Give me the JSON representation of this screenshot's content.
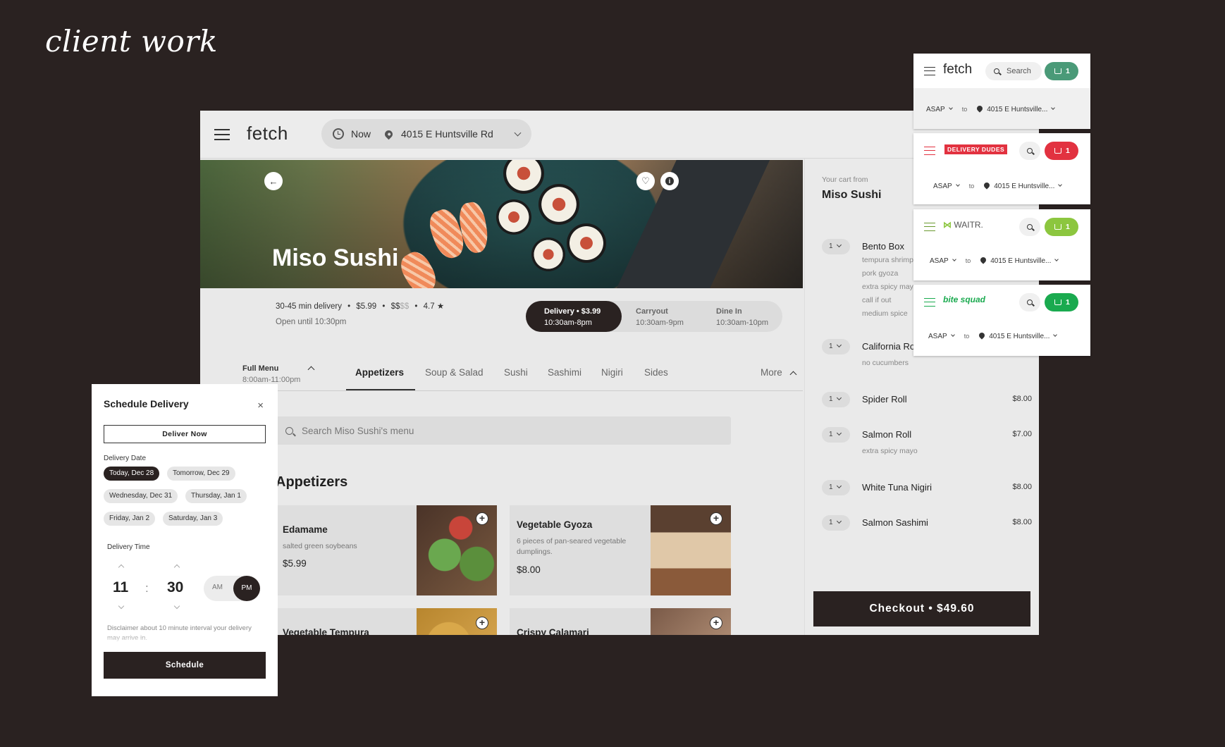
{
  "page_title": "client work",
  "app": {
    "logo": "fetch",
    "when": "Now",
    "address": "4015 E Huntsville Rd",
    "restaurant": "Miso Sushi",
    "meta_line_a": "30-45 min delivery",
    "meta_sep": "•",
    "delivery_fee": "$5.99",
    "price_dark": "$$",
    "price_dim": "$$",
    "rating": "4.7",
    "open_until": "Open until 10:30pm",
    "order_modes": [
      {
        "label": "Delivery • $3.99",
        "hours": "10:30am-8pm"
      },
      {
        "label": "Carryout",
        "hours": "10:30am-9pm"
      },
      {
        "label": "Dine In",
        "hours": "10:30am-10pm"
      }
    ],
    "full_menu": {
      "label": "Full Menu",
      "hours": "8:00am-11:00pm"
    },
    "tabs": [
      "Appetizers",
      "Soup & Salad",
      "Sushi",
      "Sashimi",
      "Nigiri",
      "Sides",
      "More"
    ],
    "search_placeholder": "Search Miso Sushi's menu",
    "section": "Appetizers",
    "items": [
      {
        "name": "Edamame",
        "desc": "salted green soybeans",
        "price": "$5.99"
      },
      {
        "name": "Vegetable Gyoza",
        "desc": "6 pieces of pan-seared vegetable dumplings.",
        "price": "$8.00"
      },
      {
        "name": "Vegetable Tempura",
        "desc": "",
        "price": ""
      },
      {
        "name": "Crispy Calamari",
        "desc": "",
        "price": ""
      }
    ]
  },
  "cart": {
    "from_label": "Your cart from",
    "restaurant": "Miso Sushi",
    "items": [
      {
        "qty": "1",
        "name": "Bento Box",
        "price": "",
        "notes": [
          "tempura shrimp",
          "pork gyoza",
          "extra spicy mayo",
          "call if out",
          "medium spice"
        ]
      },
      {
        "qty": "1",
        "name": "California Roll",
        "price": "",
        "notes": [
          "no cucumbers"
        ]
      },
      {
        "qty": "1",
        "name": "Spider Roll",
        "price": "$8.00",
        "notes": []
      },
      {
        "qty": "1",
        "name": "Salmon Roll",
        "price": "$7.00",
        "notes": [
          "extra spicy mayo"
        ]
      },
      {
        "qty": "1",
        "name": "White Tuna Nigiri",
        "price": "$8.00",
        "notes": []
      },
      {
        "qty": "1",
        "name": "Salmon Sashimi",
        "price": "$8.00",
        "notes": []
      }
    ],
    "checkout": "Checkout • $49.60"
  },
  "schedule": {
    "title": "Schedule Delivery",
    "close": "×",
    "deliver_now": "Deliver Now",
    "date_label": "Delivery Date",
    "dates": [
      "Today, Dec 28",
      "Tomorrow, Dec 29",
      "Wednesday, Dec 31",
      "Thursday, Jan 1",
      "Friday, Jan 2",
      "Saturday, Jan 3"
    ],
    "selected_date": "Today, Dec 28",
    "time_label": "Delivery Time",
    "hour": "11",
    "colon": ":",
    "minute": "30",
    "am": "AM",
    "pm": "PM",
    "selected_period": "PM",
    "disclaimer": "Disclaimer about 10 minute interval your delivery may arrive in.",
    "schedule_button": "Schedule"
  },
  "brands": [
    {
      "name": "fetch",
      "accent": "#4a9a78",
      "search": "Search",
      "cart_count": "1",
      "when": "ASAP",
      "to": "to",
      "address": "4015 E Huntsville..."
    },
    {
      "name": "DELIVERY DUDES",
      "accent": "#e23240",
      "cart_count": "1",
      "when": "ASAP",
      "to": "to",
      "address": "4015 E Huntsville..."
    },
    {
      "name": "WAITR.",
      "accent": "#8cc63f",
      "cart_count": "1",
      "when": "ASAP",
      "to": "to",
      "address": "4015 E Huntsville..."
    },
    {
      "name": "bite squad",
      "accent": "#1aaa4f",
      "cart_count": "1",
      "when": "ASAP",
      "to": "to",
      "address": "4015 E Huntsville..."
    }
  ]
}
